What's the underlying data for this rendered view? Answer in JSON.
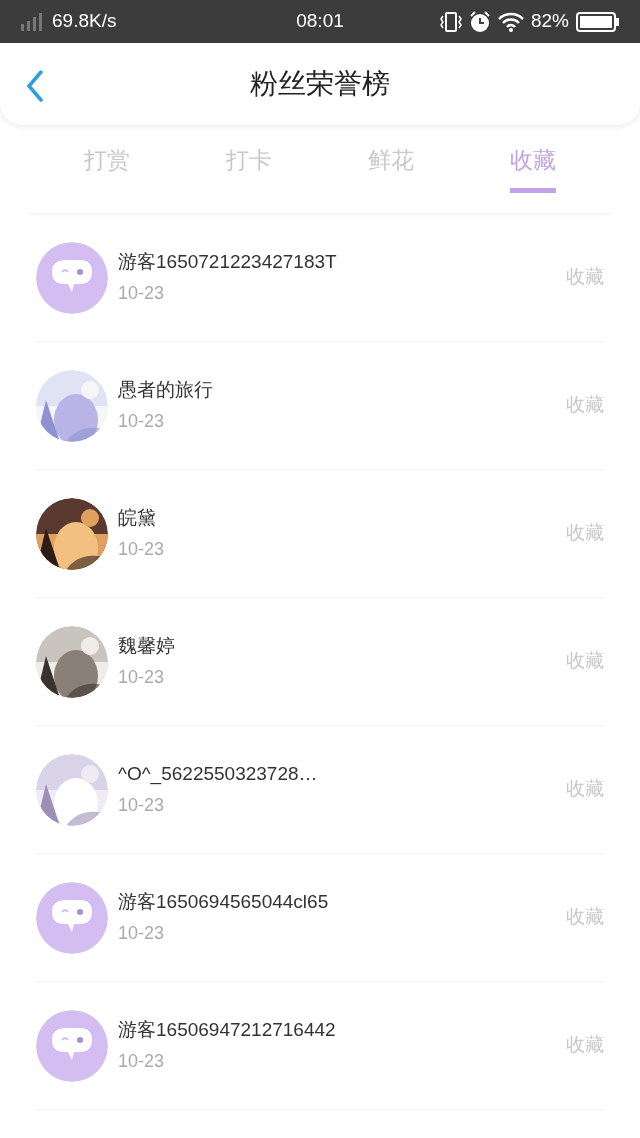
{
  "status_bar": {
    "speed": "69.8K/s",
    "time": "08:01",
    "battery": "82%"
  },
  "header": {
    "title": "粉丝荣誉榜"
  },
  "tabs": [
    {
      "label": "打赏",
      "selected": false
    },
    {
      "label": "打卡",
      "selected": false
    },
    {
      "label": "鲜花",
      "selected": false
    },
    {
      "label": "收藏",
      "selected": true
    }
  ],
  "rows": [
    {
      "kind": "default",
      "name": "游客1650721223427183T",
      "date": "10-23",
      "action": "收藏"
    },
    {
      "kind": "picture",
      "name": "愚者的旅行",
      "date": "10-23",
      "action": "收藏"
    },
    {
      "kind": "picture",
      "name": "皖黛",
      "date": "10-23",
      "action": "收藏"
    },
    {
      "kind": "picture",
      "name": "魏馨婷",
      "date": "10-23",
      "action": "收藏"
    },
    {
      "kind": "picture",
      "name": "^O^_5622550323728…",
      "date": "10-23",
      "action": "收藏"
    },
    {
      "kind": "default",
      "name": "游客1650694565044cl65",
      "date": "10-23",
      "action": "收藏"
    },
    {
      "kind": "default",
      "name": "游客16506947212716442",
      "date": "10-23",
      "action": "收藏"
    }
  ]
}
